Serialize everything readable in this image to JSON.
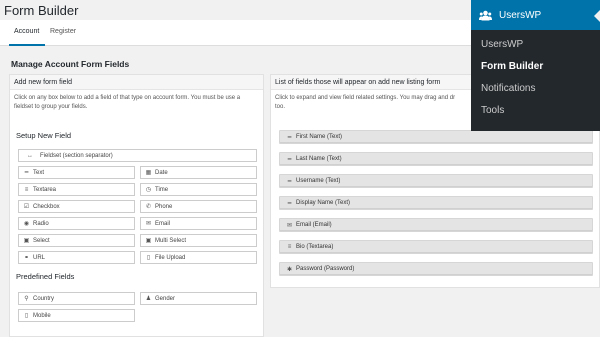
{
  "page": {
    "title": "Form Builder",
    "tabs": [
      {
        "label": "Account",
        "active": true
      },
      {
        "label": "Register",
        "active": false
      }
    ],
    "section_title": "Manage Account Form Fields"
  },
  "left_panel": {
    "heading": "Add new form field",
    "description": "Click on any box below to add a field of that type on account form. You must be use a fieldset to group your fields.",
    "setup_heading": "Setup New Field",
    "fieldset_label": "Fieldset (section separator)",
    "fields": [
      {
        "label": "Text",
        "icon": "minus-icon"
      },
      {
        "label": "Date",
        "icon": "calendar-icon"
      },
      {
        "label": "Textarea",
        "icon": "bars-icon"
      },
      {
        "label": "Time",
        "icon": "clock-icon"
      },
      {
        "label": "Checkbox",
        "icon": "checkbox-icon"
      },
      {
        "label": "Phone",
        "icon": "phone-icon"
      },
      {
        "label": "Radio",
        "icon": "radio-icon"
      },
      {
        "label": "Email",
        "icon": "envelope-icon"
      },
      {
        "label": "Select",
        "icon": "select-icon"
      },
      {
        "label": "Multi Select",
        "icon": "multiselect-icon"
      },
      {
        "label": "URL",
        "icon": "link-icon"
      },
      {
        "label": "File Upload",
        "icon": "file-icon"
      }
    ],
    "predefined_heading": "Predefined Fields",
    "predefined": [
      {
        "label": "Country",
        "icon": "map-marker-icon"
      },
      {
        "label": "Gender",
        "icon": "user-icon"
      },
      {
        "label": "Mobile",
        "icon": "mobile-icon"
      }
    ]
  },
  "right_panel": {
    "heading": "List of fields those will appear on add new listing form",
    "description": "Click to expand and view field related settings. You may drag and dr",
    "description_cont": "too.",
    "fields": [
      {
        "label": "First Name (Text)",
        "icon": "minus-icon"
      },
      {
        "label": "Last Name (Text)",
        "icon": "minus-icon"
      },
      {
        "label": "Username (Text)",
        "icon": "minus-icon"
      },
      {
        "label": "Display Name (Text)",
        "icon": "minus-icon"
      },
      {
        "label": "Email (Email)",
        "icon": "envelope-icon"
      },
      {
        "label": "Bio (Textarea)",
        "icon": "bars-icon"
      },
      {
        "label": "Password (Password)",
        "icon": "asterisk-icon"
      }
    ]
  },
  "admin_menu": {
    "title": "UsersWP",
    "items": [
      {
        "label": "UsersWP",
        "current": false
      },
      {
        "label": "Form Builder",
        "current": true
      },
      {
        "label": "Notifications",
        "current": false
      },
      {
        "label": "Tools",
        "current": false
      }
    ]
  },
  "colors": {
    "accent": "#0073aa",
    "menu_bg": "#23282d",
    "field_row_bg": "#e4e4e4"
  }
}
